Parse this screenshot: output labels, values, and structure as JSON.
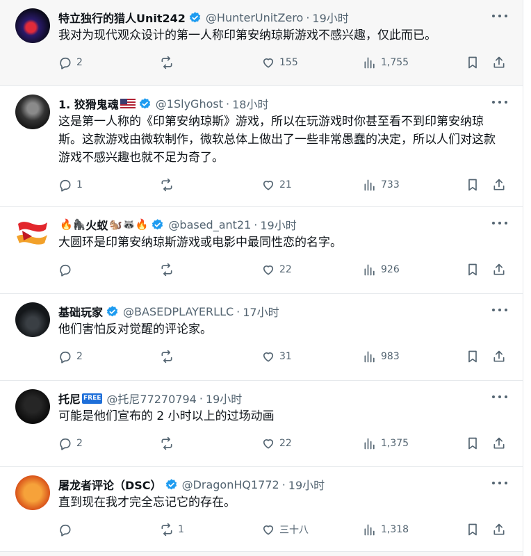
{
  "posts": [
    {
      "name": "特立独行的猎人Unit242",
      "handle": "@HunterUnitZero",
      "time": "19小时",
      "text": "我对为现代观众设计的第一人称印第安纳琼斯游戏不感兴趣，仅此而已。",
      "replies": "2",
      "reposts": "",
      "likes": "155",
      "views": "1,755",
      "avatar": "avatar-red-blue-figure"
    },
    {
      "name": "1. 狡猾鬼魂",
      "handle": "@1SlyGhost",
      "time": "18小时",
      "text": "这是第一人称的《印第安纳琼斯》游戏，所以在玩游戏时你甚至看不到印第安纳琼斯。这款游戏由微软制作，微软总体上做出了一些非常愚蠢的决定，所以人们对这款游戏不感兴趣也就不足为奇了。",
      "replies": "1",
      "reposts": "",
      "likes": "21",
      "views": "733",
      "avatar": "avatar-hooded-ghost"
    },
    {
      "name_emoji": "🔥🦍",
      "name": "火蚁",
      "name_emoji_after": "🐿️🦝🔥",
      "handle": "@based_ant21",
      "time": "19小时",
      "text": "大圆环是印第安纳琼斯游戏或电影中最同性恋的名字。",
      "replies": "",
      "reposts": "",
      "likes": "22",
      "views": "926",
      "avatar": "avatar-red-ribbon"
    },
    {
      "name": "基础玩家",
      "handle": "@BASEDPLAYERLLC",
      "time": "17小时",
      "text": "他们害怕反对觉醒的评论家。",
      "replies": "2",
      "reposts": "",
      "likes": "31",
      "views": "983",
      "avatar": "avatar-dark-figure"
    },
    {
      "name": "托尼",
      "badge": "FREE",
      "handle": "@托尼77270794",
      "time": "19小时",
      "text": "可能是他们宣布的 2 小时以上的过场动画",
      "replies": "2",
      "reposts": "",
      "likes": "22",
      "views": "1,375",
      "avatar": "avatar-dark-portrait"
    },
    {
      "name": "屠龙者评论（DSC）",
      "handle": "@DragonHQ1772",
      "time": "19小时",
      "text": "直到现在我才完全忘记它的存在。",
      "replies": "",
      "reposts": "1",
      "likes": "三十八",
      "views": "1,318",
      "avatar": "avatar-orange-logo"
    }
  ],
  "sep": "·",
  "colors": {
    "verified": "#1d9bf0",
    "secondary": "#536471",
    "text": "#0f1419",
    "divider": "#e6e9ec"
  },
  "icons": [
    "reply-icon",
    "repost-icon",
    "like-icon",
    "views-icon",
    "bookmark-icon",
    "share-icon",
    "more-icon",
    "verified-icon"
  ]
}
